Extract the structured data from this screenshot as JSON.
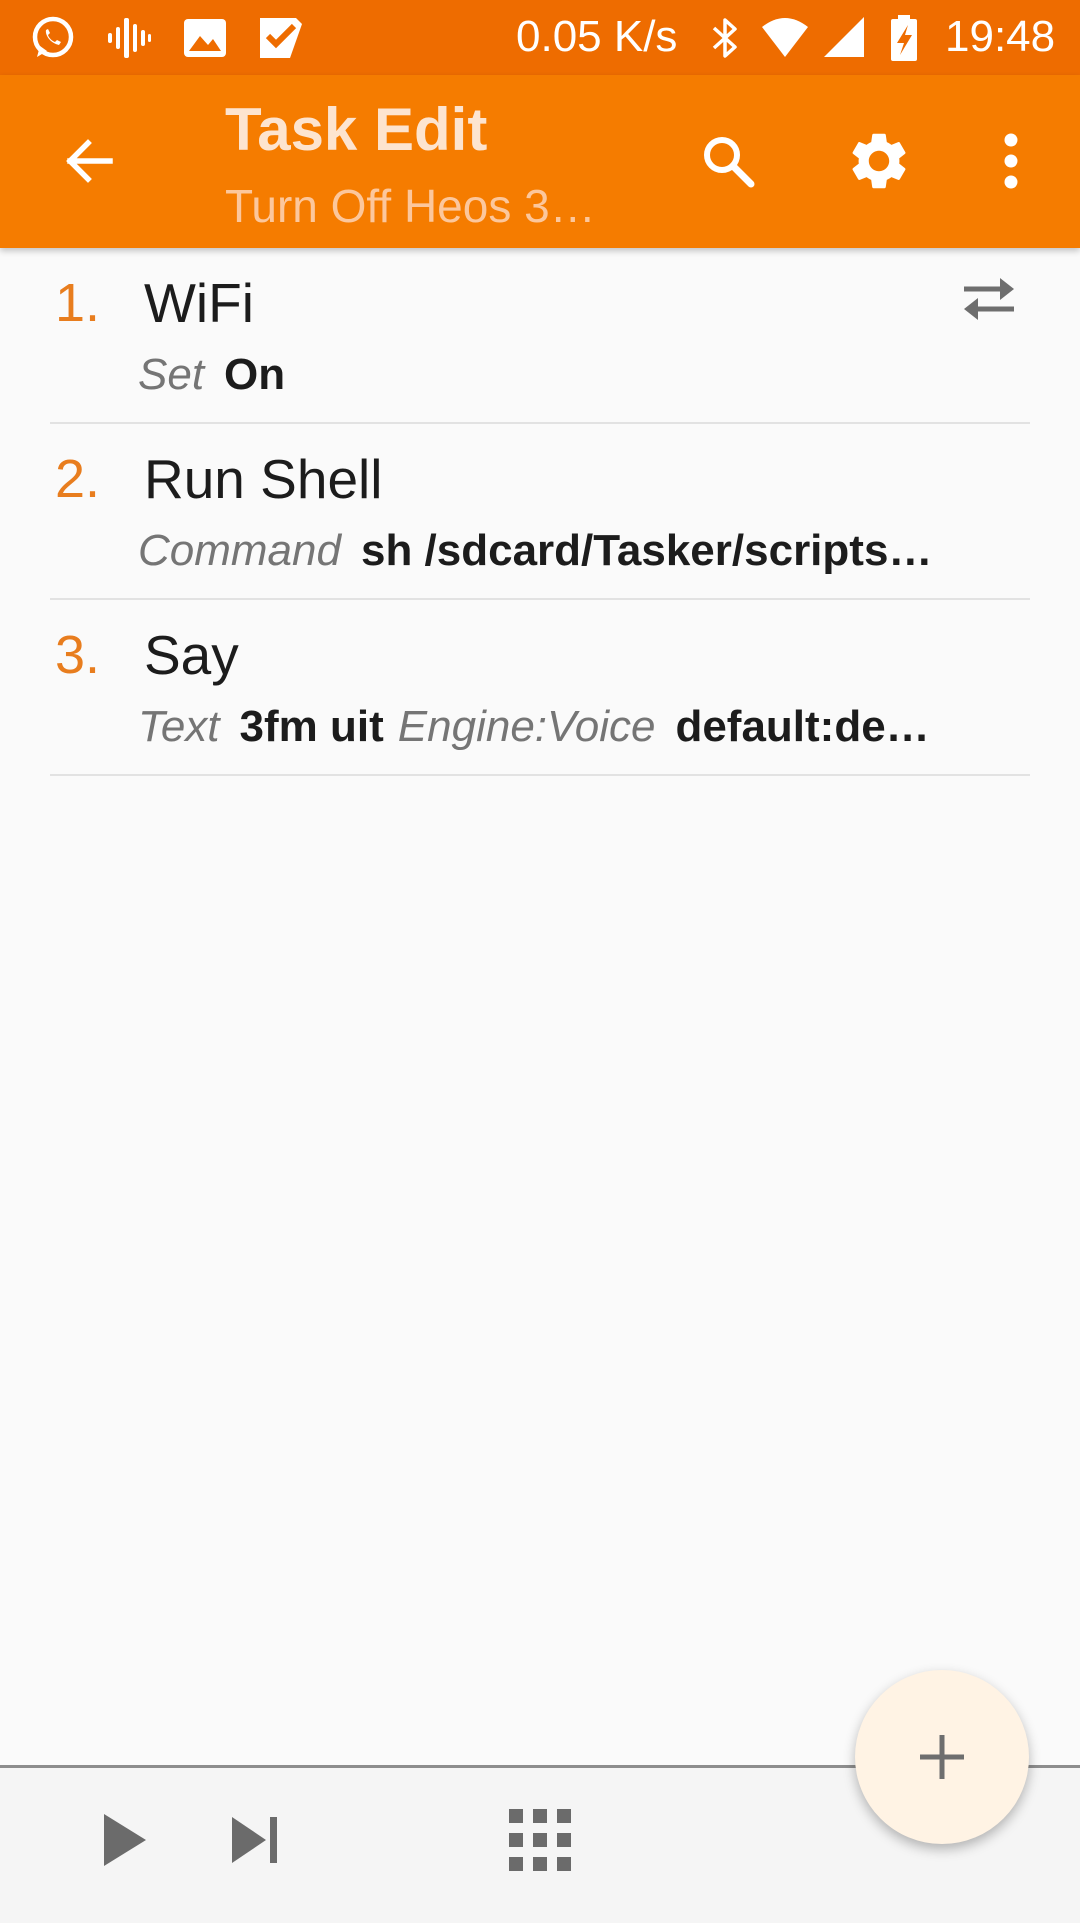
{
  "status_bar": {
    "net_speed": "0.05 K/s",
    "time": "19:48",
    "icons": [
      "whatsapp-icon",
      "voice-icon",
      "gallery-icon",
      "tasks-icon",
      "bluetooth-icon",
      "wifi-icon",
      "signal-icon",
      "battery-charging-icon"
    ]
  },
  "app_bar": {
    "title": "Task Edit",
    "subtitle": "Turn Off Heos 3…",
    "icons": [
      "back-arrow-icon",
      "search-icon",
      "gear-icon",
      "more-vert-icon"
    ]
  },
  "actions": [
    {
      "number": "1.",
      "name": "WiFi",
      "params": [
        {
          "label": "Set",
          "value": "On"
        }
      ]
    },
    {
      "number": "2.",
      "name": "Run Shell",
      "params": [
        {
          "label": "Command",
          "value": "sh /sdcard/Tasker/scripts…"
        }
      ]
    },
    {
      "number": "3.",
      "name": "Say",
      "params": [
        {
          "label": "Text",
          "value": "3fm uit"
        },
        {
          "label": "Engine:Voice",
          "value": "default:de…"
        }
      ]
    }
  ],
  "bottom_bar": {
    "icons": [
      "play-icon",
      "skip-next-icon",
      "apps-grid-icon"
    ]
  },
  "fab": {
    "icon": "plus-icon"
  },
  "colors": {
    "status_bar": "#ee6c00",
    "app_bar": "#f57c00",
    "action_number": "#e87d1e",
    "fab_background": "#fff3e4"
  }
}
